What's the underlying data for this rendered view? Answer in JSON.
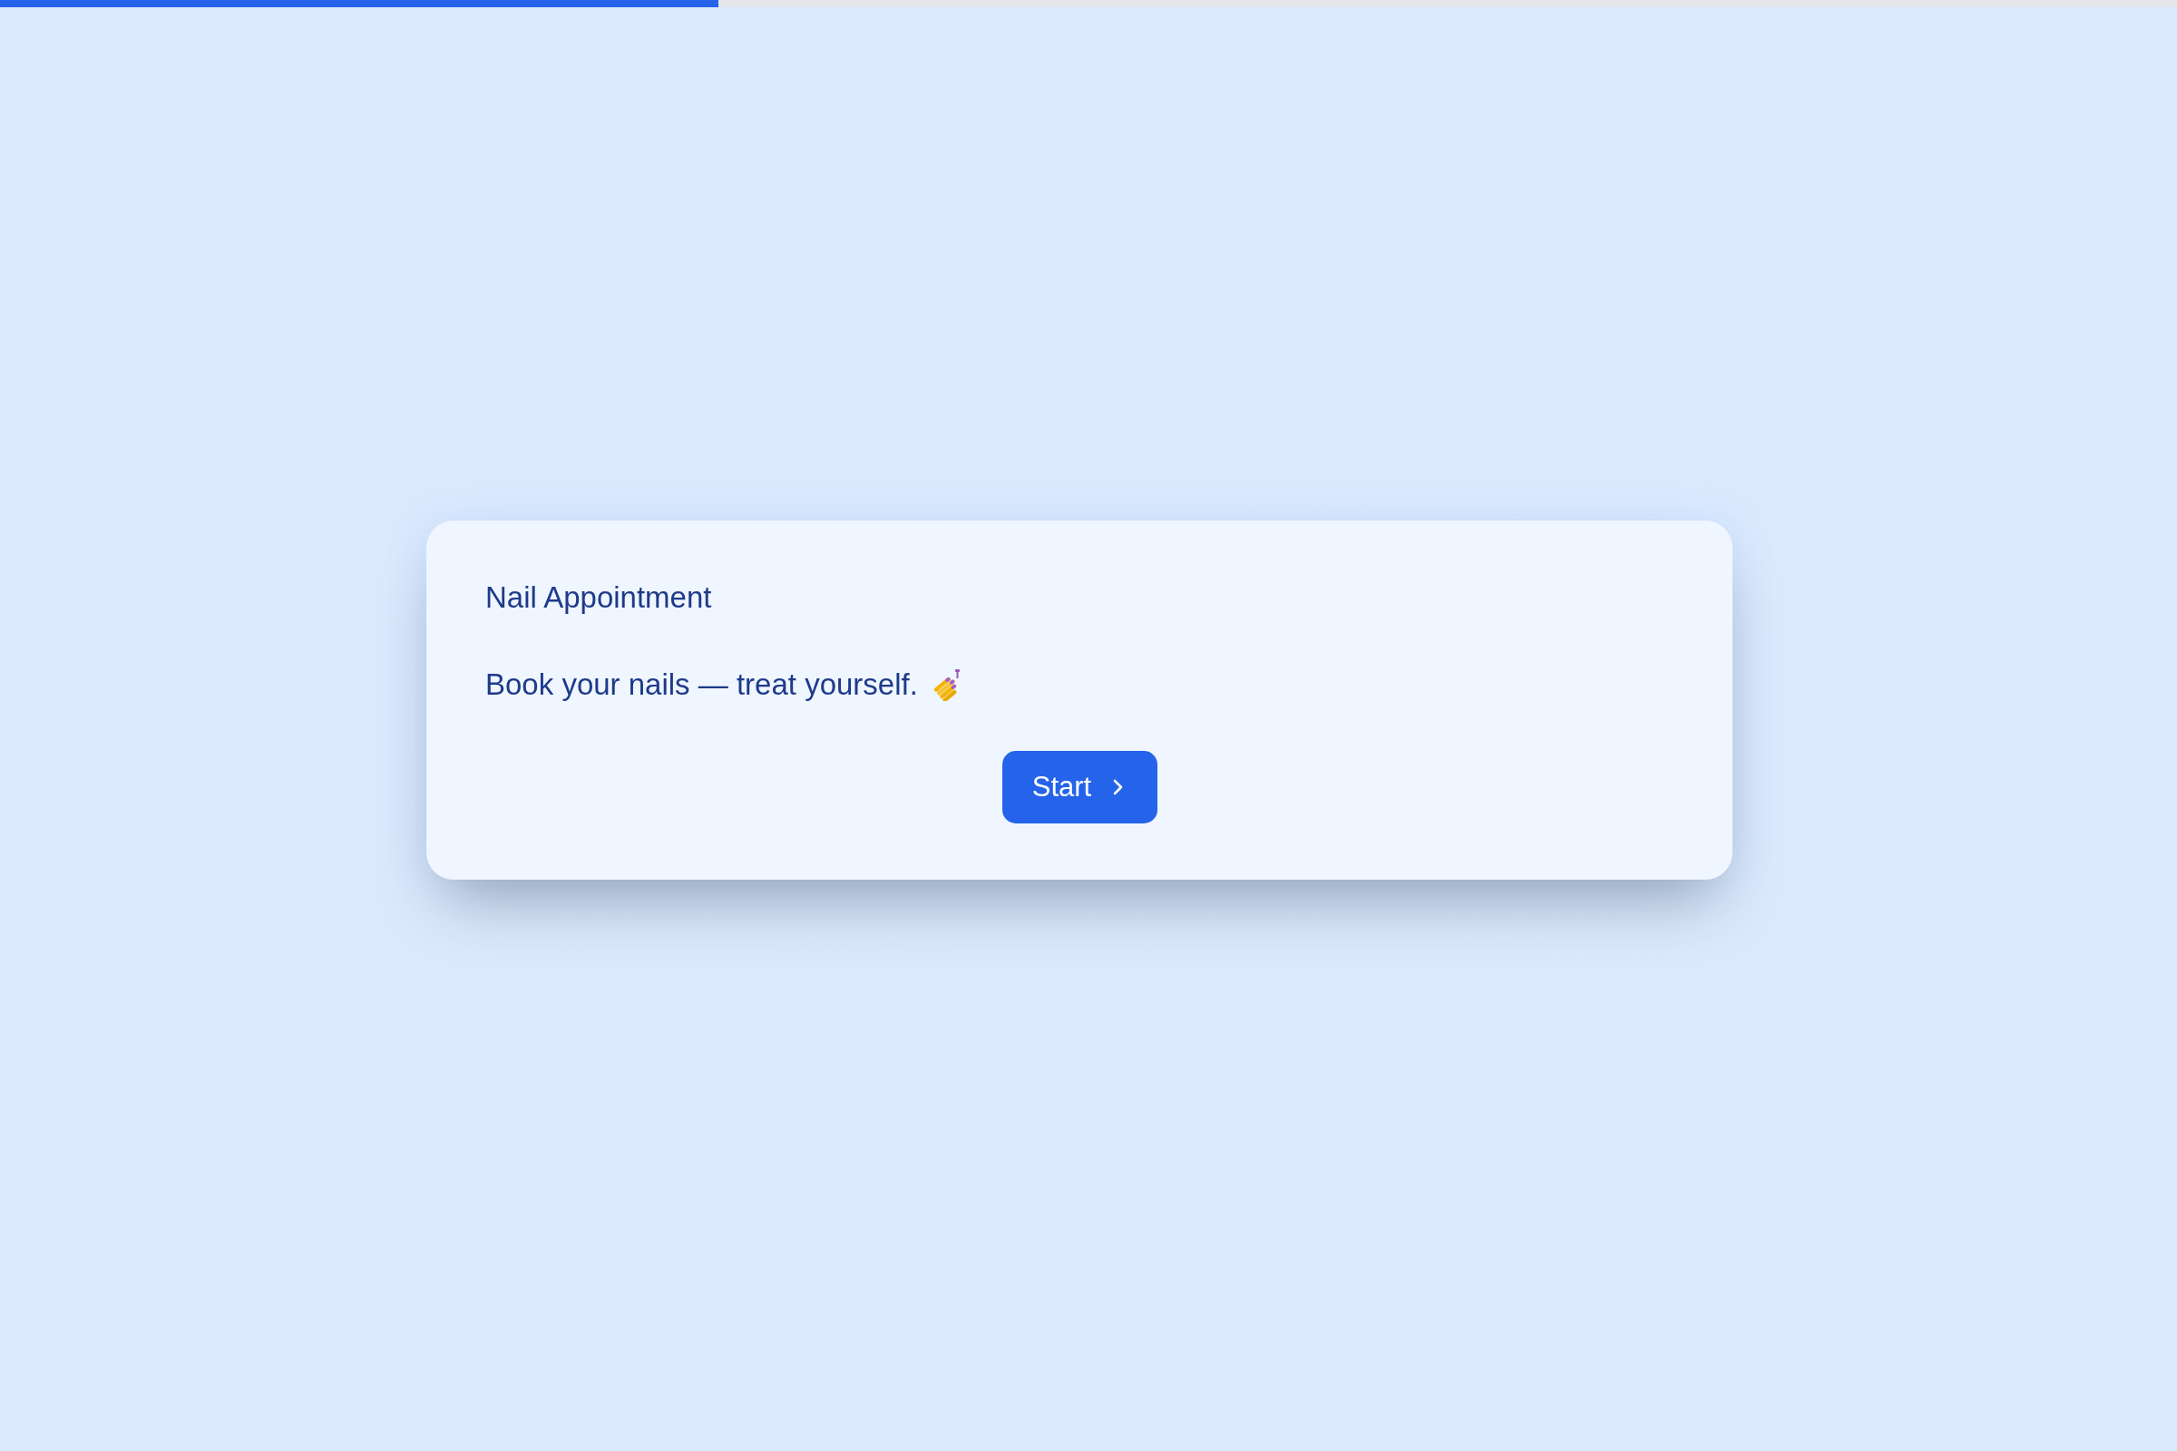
{
  "progress": {
    "level": 0.33
  },
  "card": {
    "title": "Nail Appointment",
    "description": "Book your nails — treat yourself.",
    "button": {
      "label": "Start"
    }
  }
}
